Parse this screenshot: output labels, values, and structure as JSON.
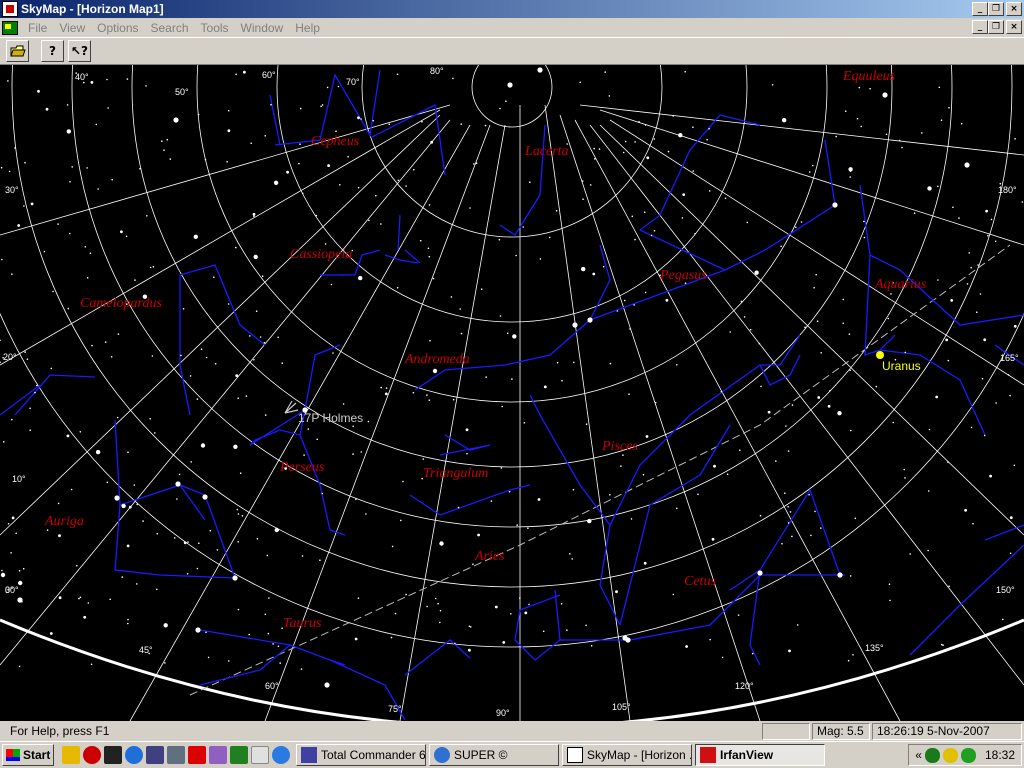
{
  "window": {
    "title": "SkyMap - [Horizon Map1]"
  },
  "window_buttons": {
    "minimize": "_",
    "restore": "❐",
    "close": "×"
  },
  "menu": [
    "File",
    "View",
    "Options",
    "Search",
    "Tools",
    "Window",
    "Help"
  ],
  "toolbar": {
    "open_icon": "open-folder-icon",
    "help_icon": "?",
    "context_help_icon": "↖?"
  },
  "map": {
    "colors": {
      "background": "#000000",
      "grid": "#ffffff",
      "lines": "#1a1aff",
      "labels": "#cc0000",
      "planet": "#ffff00",
      "comet": "#cccccc"
    },
    "constellations": [
      "Equuleus",
      "Cepheus",
      "Lacerta",
      "Cassiopeia",
      "Pegasus",
      "Aquarius",
      "Camelopardus",
      "Andromeda",
      "Pisces",
      "Triangulum",
      "Perseus",
      "Auriga",
      "Aries",
      "Cetus",
      "Taurus"
    ],
    "objects": {
      "planet": "Uranus",
      "comet": "17P Holmes"
    },
    "grid_labels": [
      "40°",
      "50°",
      "60°",
      "70°",
      "80°",
      "30°",
      "20°",
      "10°",
      "0°",
      "180°",
      "165°",
      "150°",
      "135°",
      "120°",
      "105°",
      "90°",
      "75°",
      "60°",
      "45°",
      "30°"
    ]
  },
  "status": {
    "help": "For Help, press F1",
    "mag": "Mag: 5.5",
    "datetime": "18:26:19 5-Nov-2007"
  },
  "taskbar": {
    "start": "Start",
    "tasks": [
      "Total Commander 6....",
      "SUPER ©",
      "SkyMap - [Horizon ...",
      "IrfanView"
    ],
    "clock": "18:32",
    "tray_chevron": "«"
  }
}
